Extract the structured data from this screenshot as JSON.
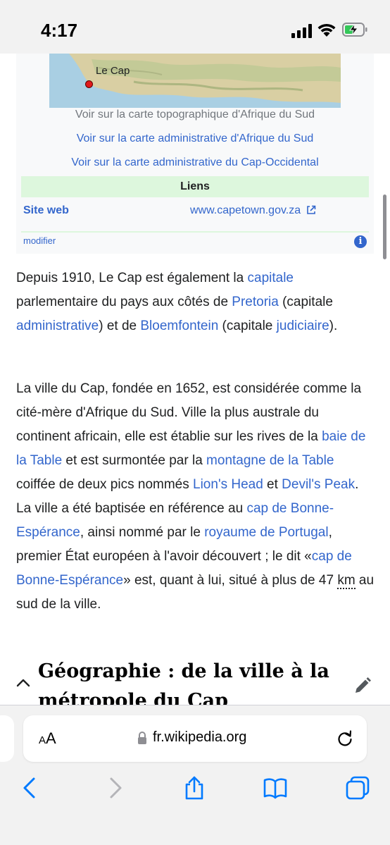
{
  "status_bar": {
    "time": "4:17"
  },
  "infobox": {
    "map_label": "Le Cap",
    "map_links": {
      "topo": "Voir sur la carte topographique d'Afrique du Sud",
      "admin": "Voir sur la carte administrative d'Afrique du Sud",
      "province": "Voir sur la carte administrative du Cap-Occidental"
    },
    "links_header": "Liens",
    "website_label": "Site web",
    "website_url": "www.capetown.gov.za",
    "edit_link": "modifier",
    "info_icon": "i"
  },
  "article": {
    "p1": {
      "t1": "Depuis 1910, Le Cap est également la ",
      "l1": "capitale",
      "t2": " parlementaire du pays aux côtés de ",
      "l2": "Pretoria",
      "t3": " (capitale ",
      "l3": "administrative",
      "t4": ") et de ",
      "l4": "Bloemfontein",
      "t5": " (capitale ",
      "l5": "judiciaire",
      "t6": ")."
    },
    "p2": {
      "t1": "La ville du Cap, fondée en 1652, est considérée comme la cité-mère d'Afrique du Sud. Ville la plus australe du continent africain, elle est établie sur les rives de la ",
      "l1": "baie de la Table",
      "t2": " et est surmontée par la ",
      "l2": "montagne de la Table",
      "t3": " coiffée de deux pics nommés ",
      "l3": "Lion's Head",
      "t4": " et ",
      "l4": "Devil's Peak",
      "t5": ". La ville a été baptisée en référence au ",
      "l5": "cap de Bonne-Espérance",
      "t6": ", ainsi nommé par le ",
      "l6": "royaume de Portugal",
      "t7": ", premier État européen à l'avoir découvert ; le dit «",
      "l7": "cap de Bonne-Espérance",
      "t8": "» est, quant à lui, situé à plus de 47 ",
      "abbr": "km",
      "t9": " au sud de la ville."
    },
    "section_title": "Géographie : de la ville à la métropole du Cap"
  },
  "browser": {
    "text_size_label_small": "A",
    "text_size_label_large": "A",
    "url": "fr.wikipedia.org"
  },
  "icons": {
    "signal": "cellular-signal-icon",
    "wifi": "wifi-icon",
    "battery": "battery-charging-icon",
    "external": "external-link-icon",
    "chevron": "chevron-up-icon",
    "edit": "pencil-icon",
    "lock": "lock-icon",
    "reload": "reload-icon",
    "back": "back-icon",
    "forward": "forward-icon",
    "share": "share-icon",
    "bookmarks": "bookmarks-icon",
    "tabs": "tabs-icon"
  },
  "colors": {
    "link": "#3366cc",
    "liens_header_bg": "#ddf7dd",
    "infobox_bg": "#f8f9fa",
    "ios_blue": "#007aff"
  }
}
